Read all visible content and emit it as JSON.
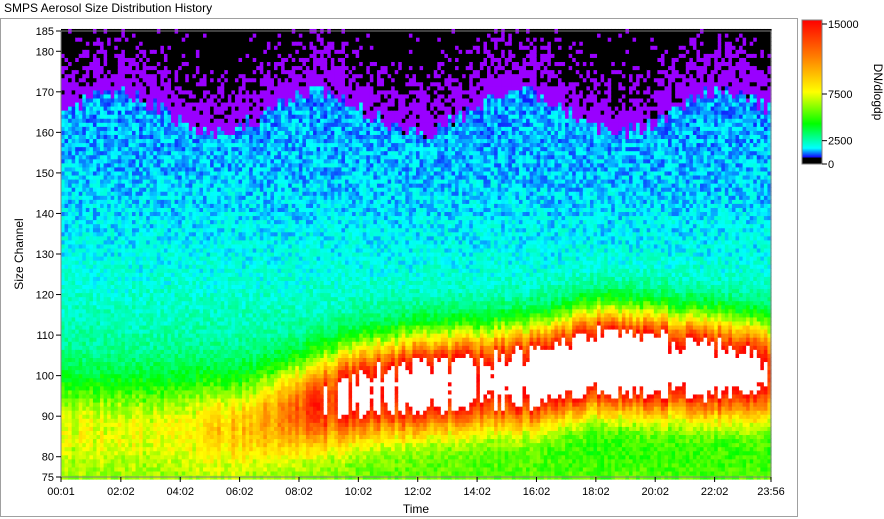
{
  "window": {
    "title": "SMPS Aerosol Size Distribution History"
  },
  "chart_data": {
    "type": "heatmap",
    "title": "SMPS Aerosol Size Distribution History",
    "xlabel": "Time",
    "ylabel": "Size Channel",
    "x_tick_labels": [
      "00:01",
      "02:02",
      "04:02",
      "06:02",
      "08:02",
      "10:02",
      "12:02",
      "14:02",
      "16:02",
      "18:02",
      "20:02",
      "22:02",
      "23:56"
    ],
    "x_tick_hours": [
      0.017,
      2.033,
      4.033,
      6.033,
      8.033,
      10.033,
      12.033,
      14.033,
      16.033,
      18.033,
      20.033,
      22.033,
      23.933
    ],
    "xlim_hours": [
      0.017,
      23.933
    ],
    "y_ticks": [
      75,
      80,
      90,
      100,
      110,
      120,
      130,
      140,
      150,
      160,
      170,
      180,
      185
    ],
    "ylim": [
      75,
      185
    ],
    "colorbar": {
      "label": "DN/dlogdp",
      "ticks": [
        0,
        2500,
        7500,
        15000
      ],
      "tick_labels": [
        "0",
        "2500",
        "7500",
        "15000"
      ],
      "range": [
        0,
        15000
      ],
      "colors": [
        "#000000",
        "#1010ff",
        "#00ffff",
        "#00ff00",
        "#ffff00",
        "#ff8000",
        "#ff0000",
        "#ffffff"
      ]
    },
    "features": {
      "above_range_color": "#ffffff",
      "no_data_color": "#000000",
      "top_region_color": "#9900ff",
      "mode_peak_channel_by_hour": [
        [
          0,
          88
        ],
        [
          6,
          88
        ],
        [
          8,
          92
        ],
        [
          10,
          96
        ],
        [
          12,
          98
        ],
        [
          14,
          99
        ],
        [
          16,
          100
        ],
        [
          18,
          104
        ],
        [
          20,
          103
        ],
        [
          22,
          102
        ],
        [
          23.93,
          101
        ]
      ],
      "mode_peak_value_by_hour": [
        [
          0,
          3000
        ],
        [
          4,
          3500
        ],
        [
          7,
          6000
        ],
        [
          8,
          9000
        ],
        [
          10,
          13000
        ],
        [
          12,
          15500
        ],
        [
          14,
          14000
        ],
        [
          16,
          17000
        ],
        [
          18,
          19000
        ],
        [
          20,
          18000
        ],
        [
          22,
          16500
        ],
        [
          23.93,
          12000
        ]
      ]
    }
  }
}
